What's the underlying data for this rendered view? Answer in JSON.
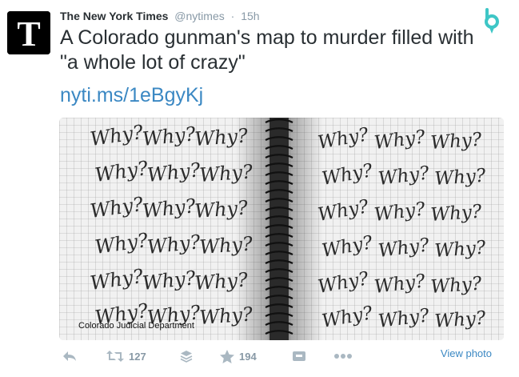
{
  "tweet": {
    "author_name": "The New York Times",
    "handle": "@nytimes",
    "separator": "·",
    "time": "15h",
    "text": "A Colorado gunman's map to murder filled with \"a whole lot of crazy\"",
    "link": "nyti.ms/1eBgyKj"
  },
  "photo": {
    "credit": "Colorado Judicial Department",
    "handwriting_word": "Why?"
  },
  "actions": {
    "reply_icon": "reply-icon",
    "retweet_icon": "retweet-icon",
    "retweet_count": "127",
    "buffer_icon": "buffer-stack-icon",
    "favorite_icon": "star-icon",
    "favorite_count": "194",
    "extension_icon": "extension-icon",
    "more_icon": "more-dots-icon",
    "view_photo": "View photo"
  },
  "colors": {
    "link": "#3b88c3",
    "muted": "#8899a6",
    "icon": "#aab8c2",
    "brand_teal": "#3ec6c6"
  }
}
